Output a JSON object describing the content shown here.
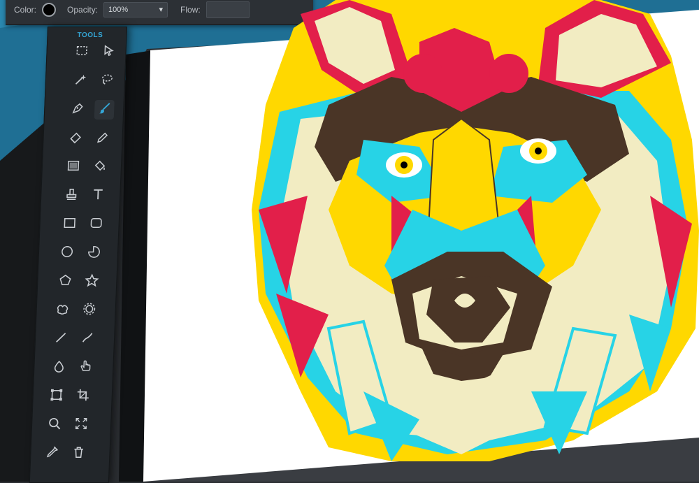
{
  "toolbar": {
    "color_label": "Color:",
    "color_value": "#000000",
    "opacity_label": "Opacity:",
    "opacity_value": "100%",
    "flow_label": "Flow:"
  },
  "tools_panel": {
    "title": "TOOLS",
    "accent": "#34a6d6",
    "active_tool": "brush",
    "tools": [
      "marquee",
      "move",
      "magic-wand",
      "lasso",
      "pen",
      "brush",
      "eraser",
      "pencil",
      "gradient",
      "paint-bucket",
      "clone-stamp",
      "text",
      "rectangle",
      "rounded-rectangle",
      "ellipse",
      "pie",
      "polygon",
      "star",
      "blob",
      "gear",
      "line",
      "curve",
      "drop",
      "hand",
      "transform",
      "crop",
      "zoom",
      "fit-screen",
      "eyedropper",
      "trash"
    ]
  },
  "artwork": {
    "subject": "geometric-wolf-illustration",
    "palette": [
      "#e21f4a",
      "#ffd800",
      "#27d3e6",
      "#f2ecc2",
      "#4a3526",
      "#ffffff"
    ]
  }
}
